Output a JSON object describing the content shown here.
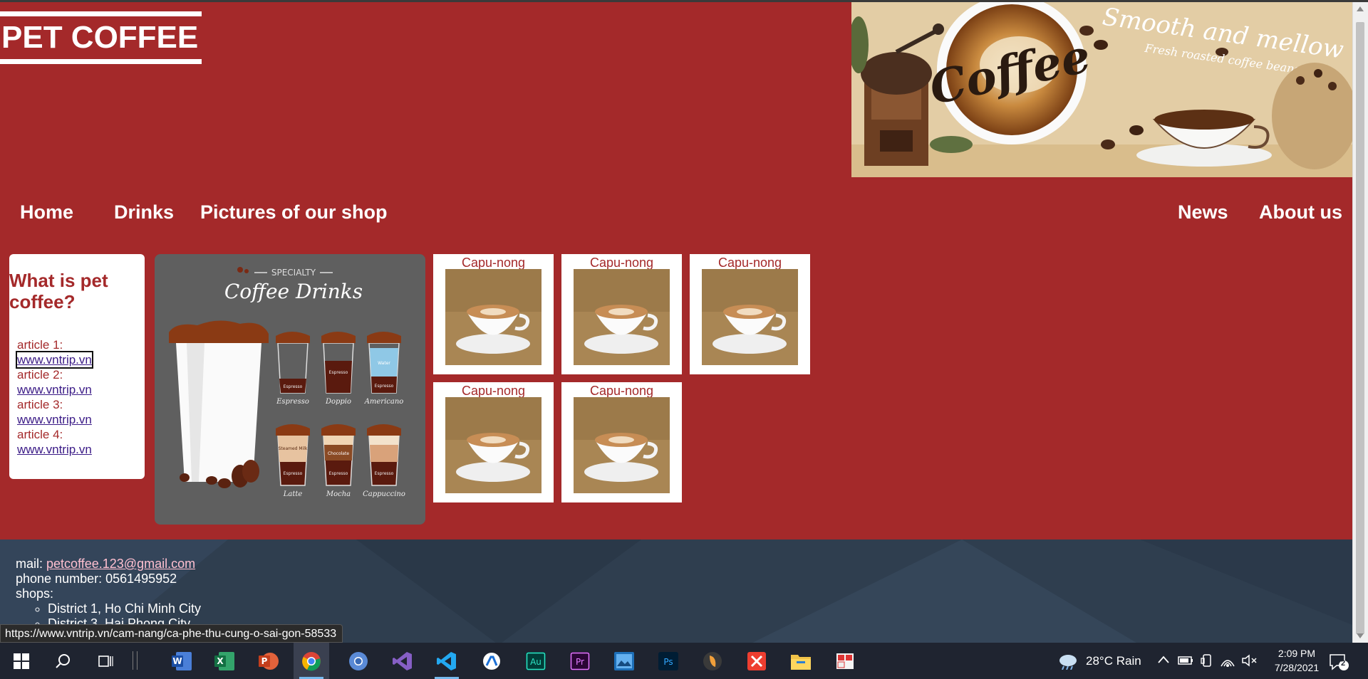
{
  "site": {
    "logo": "PET COFFEE",
    "banner": {
      "main_word": "Coffee",
      "tagline": "Smooth and mellow",
      "sub_tagline": "Fresh roasted coffee beans"
    }
  },
  "nav": {
    "home": "Home",
    "drinks": "Drinks",
    "pictures": "Pictures of our shop",
    "news": "News",
    "about": "About us"
  },
  "sidebar": {
    "title": "What is pet coffee?",
    "articles": [
      {
        "label": "article 1:",
        "link": "www.vntrip.vn"
      },
      {
        "label": "article 2:",
        "link": "www.vntrip.vn"
      },
      {
        "label": "article 3:",
        "link": "www.vntrip.vn"
      },
      {
        "label": "article 4:",
        "link": "www.vntrip.vn"
      }
    ]
  },
  "poster": {
    "top": "SPECIALTY",
    "title": "Coffee Drinks",
    "drinks": [
      "Espresso",
      "Doppio",
      "Americano",
      "Latte",
      "Mocha",
      "Cappuccino"
    ],
    "layers": {
      "espresso": "Espresso",
      "water": "Water",
      "milk": "Milk",
      "chocolate": "Chocolate",
      "foam": "Foam",
      "steamed_milk": "Steamed Milk"
    }
  },
  "gallery": {
    "items": [
      "Capu-nong",
      "Capu-nong",
      "Capu-nong",
      "Capu-nong",
      "Capu-nong"
    ]
  },
  "footer": {
    "mail_label": "mail:",
    "mail": "petcoffee.123@gmail.com",
    "phone": "phone number: 0561495952",
    "shops_label": "shops:",
    "shops": [
      "District 1, Ho Chi Minh City",
      "District 3, Hai Phong City"
    ]
  },
  "status_url": "https://www.vntrip.vn/cam-nang/ca-phe-thu-cung-o-sai-gon-58533",
  "taskbar": {
    "weather": "28°C  Rain",
    "time": "2:09 PM",
    "date": "7/28/2021",
    "notif_count": "2",
    "apps": [
      "start-icon",
      "search-icon",
      "task-view-icon",
      "word-icon",
      "excel-icon",
      "powerpoint-icon",
      "chrome-icon",
      "chromium-icon",
      "visual-studio-icon",
      "vscode-icon",
      "paint-icon",
      "audition-icon",
      "premiere-icon",
      "video-editor-icon",
      "photoshop-icon",
      "fl-studio-icon",
      "xmind-icon",
      "file-explorer-icon",
      "sticky-app-icon"
    ]
  },
  "colors": {
    "page_bg": "#a4292a",
    "footer_bg": "#2f3e4f",
    "link": "#3a1a86",
    "taskbar": "#1f2430"
  }
}
